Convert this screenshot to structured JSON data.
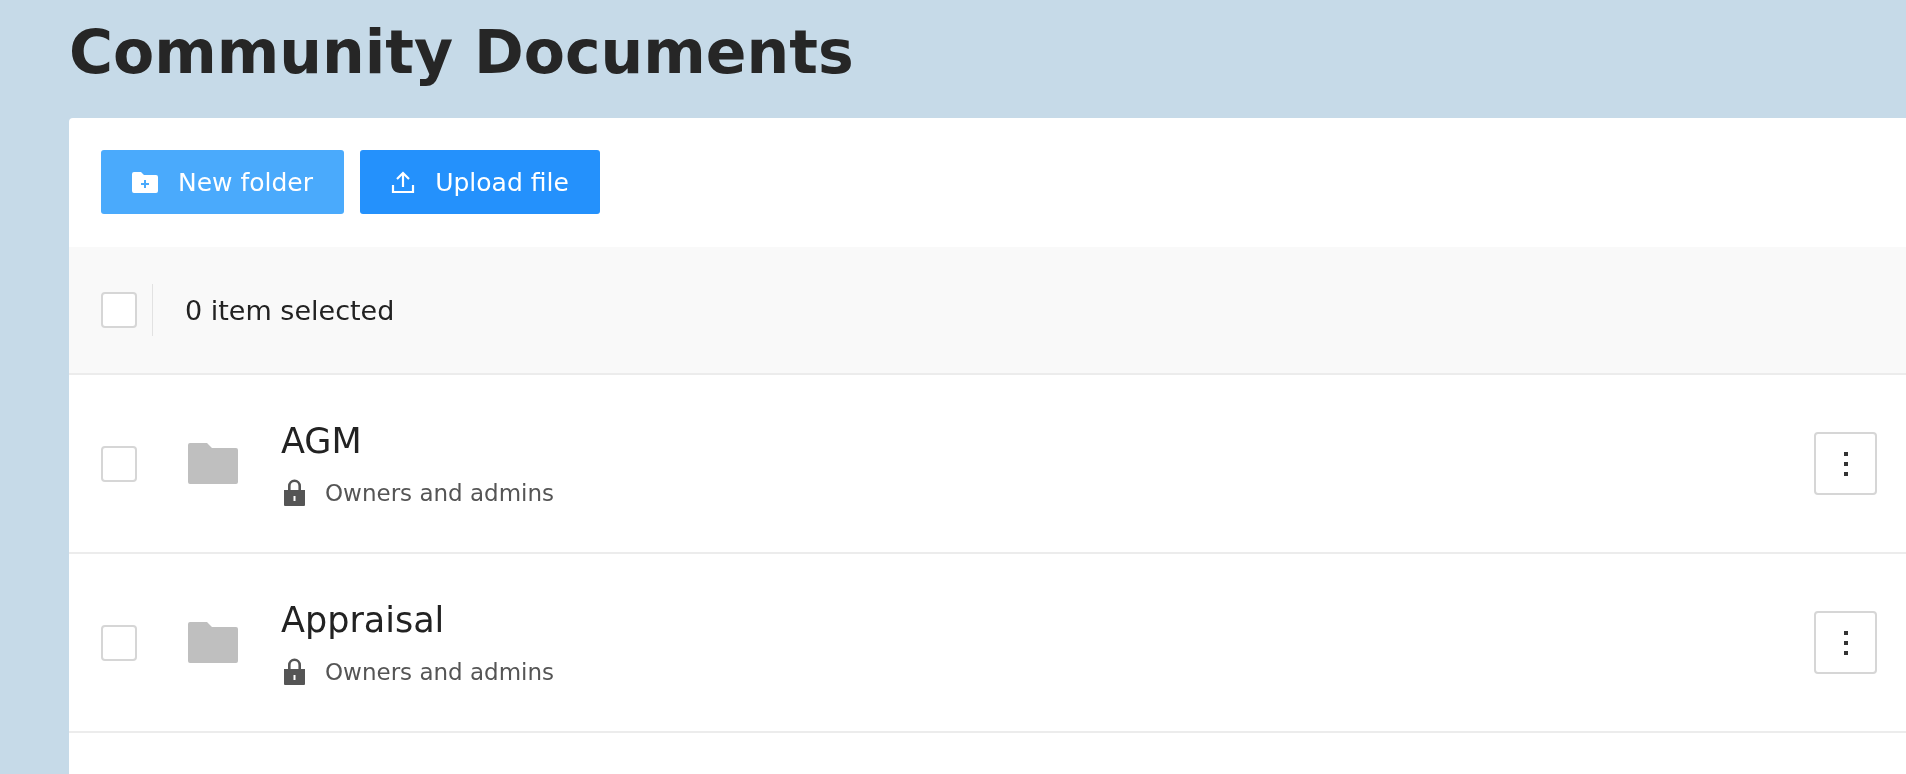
{
  "page": {
    "title": "Community Documents"
  },
  "toolbar": {
    "buttons": [
      {
        "kind": "new-folder",
        "label": "New folder"
      },
      {
        "kind": "upload",
        "label": "Upload file"
      }
    ]
  },
  "selection_bar": {
    "checked": false,
    "text": "0 item selected"
  },
  "items": [
    {
      "kind": "folder",
      "name": "AGM",
      "access": "Owners and admins",
      "checked": false
    },
    {
      "kind": "folder",
      "name": "Appraisal",
      "access": "Owners and admins",
      "checked": false
    }
  ]
}
